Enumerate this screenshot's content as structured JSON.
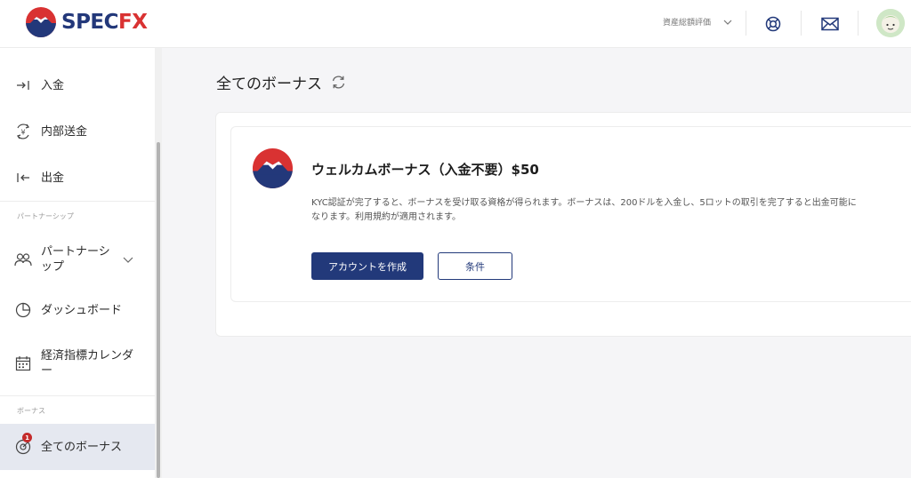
{
  "brand": {
    "name_part1": "SPEC",
    "name_part2": "FX",
    "primary_color": "#23387a",
    "accent_color": "#d93232"
  },
  "header": {
    "account_select_label": "資産総額評価",
    "icons": [
      "support-lifebuoy-icon",
      "mail-icon"
    ],
    "avatar": "user-avatar"
  },
  "sidebar": {
    "items": [
      {
        "label": "入金",
        "icon": "deposit-arrow-icon"
      },
      {
        "label": "内部送金",
        "icon": "internal-transfer-yen-icon"
      },
      {
        "label": "出金",
        "icon": "withdraw-arrow-icon"
      },
      {
        "label": "パートナーシップ",
        "icon": "partners-icon"
      },
      {
        "label": "ダッシュボード",
        "icon": "pie-chart-icon"
      },
      {
        "label": "経済指標カレンダー",
        "icon": "calendar-icon"
      },
      {
        "label": "全てのボーナス",
        "icon": "bonus-target-icon",
        "badge": "1",
        "active": true
      }
    ],
    "sections": {
      "partnership": "パートナーシップ",
      "bonus": "ボーナス"
    }
  },
  "main": {
    "page_title": "全てのボーナス",
    "bonus": {
      "title": "ウェルカムボーナス（入金不要）$50",
      "description": "KYC認証が完了すると、ボーナスを受け取る資格が得られます。ボーナスは、200ドルを入金し、5ロットの取引を完了すると出金可能に",
      "description_line2": "なります。利用規約が適用されます。",
      "primary_button": "アカウントを作成",
      "secondary_button": "条件"
    }
  }
}
